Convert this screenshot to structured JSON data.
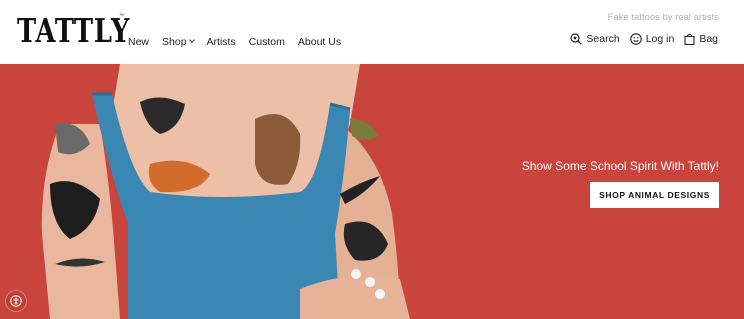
{
  "brand": {
    "logo_text": "TATTLY",
    "trademark": "™"
  },
  "header": {
    "tagline": "Fake tattoos by real artists",
    "nav": [
      {
        "label": "New"
      },
      {
        "label": "Shop",
        "has_dropdown": true
      },
      {
        "label": "Artists"
      },
      {
        "label": "Custom"
      },
      {
        "label": "About Us"
      }
    ],
    "utility": {
      "search_label": "Search",
      "login_label": "Log in",
      "bag_label": "Bag"
    }
  },
  "hero": {
    "heading": "Show Some School Spirit With Tattly!",
    "button_label": "SHOP ANIMAL DESIGNS",
    "background_color": "#c8443c"
  },
  "icons": {
    "search": "search-icon",
    "login": "smiley-icon",
    "bag": "bag-icon",
    "accessibility": "accessibility-icon"
  }
}
